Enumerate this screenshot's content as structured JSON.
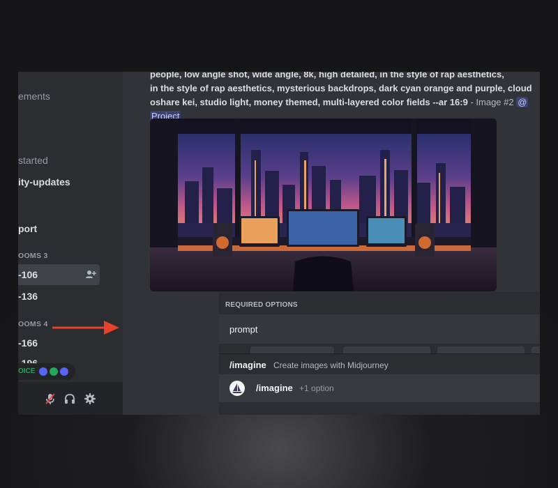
{
  "sidebar": {
    "channels": [
      {
        "label": "ements"
      },
      {
        "label": "started"
      },
      {
        "label": "ity-updates"
      },
      {
        "label": "port"
      }
    ],
    "categories": [
      {
        "label": "OOMS 3"
      },
      {
        "label": "OOMS 4"
      }
    ],
    "rooms": [
      {
        "label": "-106"
      },
      {
        "label": "-136"
      },
      {
        "label": "-166"
      },
      {
        "label": "-196"
      }
    ],
    "voice": {
      "label": "OICE"
    }
  },
  "message": {
    "line1": "people, low angle shot, wide angle, 8k, high detailed, in the style of rap aesthetics,",
    "line2": "in the style of rap aesthetics, mysterious backdrops, dark cyan orange and purple, cloud",
    "line3": "oshare kei, studio light, money themed, multi-layered color fields --ar 16:9",
    "suffix": " - Image #2 ",
    "mention": "@",
    "line4": "Project"
  },
  "popup": {
    "required_header": "REQUIRED OPTIONS",
    "prompt_label": "prompt",
    "command": {
      "name": "/imagine",
      "description": "Create images with Midjourney"
    },
    "input": {
      "command": "/imagine",
      "options": "+1 option"
    }
  },
  "colors": {
    "accent": "#5865f2",
    "arrow": "#e8402a",
    "voice_green": "#23a55a"
  }
}
